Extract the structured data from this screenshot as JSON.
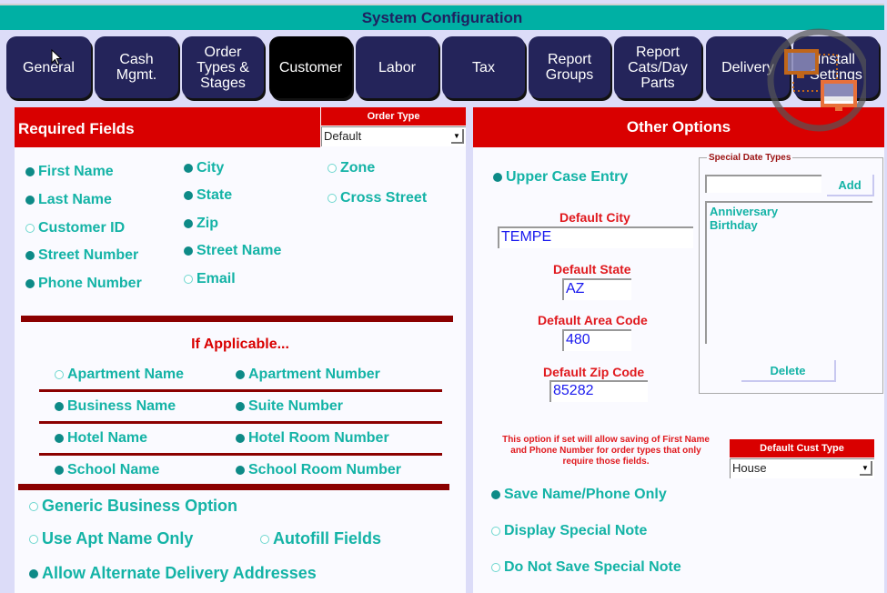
{
  "window": {
    "title": "System Configuration"
  },
  "tabs": [
    {
      "label": "General",
      "active": false
    },
    {
      "label": "Cash\nMgmt.",
      "active": false
    },
    {
      "label": "Order\nTypes &\nStages",
      "active": false
    },
    {
      "label": "Customer",
      "active": true
    },
    {
      "label": "Labor",
      "active": false
    },
    {
      "label": "Tax",
      "active": false
    },
    {
      "label": "Report\nGroups",
      "active": false
    },
    {
      "label": "Report\nCats/Day\nParts",
      "active": false
    },
    {
      "label": "Delivery",
      "active": false
    },
    {
      "label": "Install\nSettings",
      "active": false
    }
  ],
  "required_fields": {
    "header": "Required Fields",
    "order_type": {
      "label": "Order Type",
      "value": "Default"
    },
    "col1": [
      {
        "label": "First Name",
        "checked": true
      },
      {
        "label": "Last Name",
        "checked": true
      },
      {
        "label": "Customer ID",
        "checked": false
      },
      {
        "label": "Street Number",
        "checked": true
      },
      {
        "label": "Phone Number",
        "checked": true
      }
    ],
    "col2": [
      {
        "label": "City",
        "checked": true
      },
      {
        "label": "State",
        "checked": true
      },
      {
        "label": "Zip",
        "checked": true
      },
      {
        "label": "Street Name",
        "checked": true
      },
      {
        "label": "Email",
        "checked": false
      }
    ],
    "col3": [
      {
        "label": "Zone",
        "checked": false
      },
      {
        "label": "Cross Street",
        "checked": false
      }
    ]
  },
  "if_applicable": {
    "header": "If Applicable...",
    "rows": [
      [
        {
          "label": "Apartment Name",
          "checked": false
        },
        {
          "label": "Apartment Number",
          "checked": true
        }
      ],
      [
        {
          "label": "Business Name",
          "checked": true
        },
        {
          "label": "Suite Number",
          "checked": true
        }
      ],
      [
        {
          "label": "Hotel Name",
          "checked": true
        },
        {
          "label": "Hotel Room Number",
          "checked": true
        }
      ],
      [
        {
          "label": "School Name",
          "checked": true
        },
        {
          "label": "School Room Number",
          "checked": true
        }
      ]
    ]
  },
  "bottom_options": {
    "generic_business": {
      "label": "Generic Business Option",
      "checked": false
    },
    "use_apt_name": {
      "label": "Use Apt Name Only",
      "checked": false
    },
    "autofill": {
      "label": "Autofill Fields",
      "checked": false
    },
    "alt_delivery": {
      "label": "Allow Alternate Delivery Addresses",
      "checked": true
    }
  },
  "other_options": {
    "header": "Other Options",
    "upper_case": {
      "label": "Upper Case Entry",
      "checked": true
    },
    "default_city": {
      "label": "Default City",
      "value": "TEMPE"
    },
    "default_state": {
      "label": "Default State",
      "value": "AZ"
    },
    "default_area_code": {
      "label": "Default Area Code",
      "value": "480"
    },
    "default_zip": {
      "label": "Default Zip Code",
      "value": "85282"
    },
    "special_date_types": {
      "legend": "Special Date Types",
      "input_value": "",
      "add_label": "Add",
      "delete_label": "Delete",
      "items": [
        "Anniversary",
        "Birthday"
      ]
    },
    "note": "This option if set will allow saving of First Name and Phone Number for order types that only require those fields.",
    "default_cust_type": {
      "label": "Default Cust Type",
      "value": "House"
    },
    "save_name_phone": {
      "label": "Save Name/Phone Only",
      "checked": true
    },
    "display_special_note": {
      "label": "Display Special Note",
      "checked": false
    },
    "do_not_save_note": {
      "label": "Do Not Save Special Note",
      "checked": false
    }
  },
  "icons": {
    "remote_connection": "remote-connection-icon",
    "cursor": "mouse-pointer-icon"
  },
  "colors": {
    "title_bar": "#00b0a4",
    "tab_bg": "#24245a",
    "tab_active": "#000000",
    "header_red": "#d90000",
    "option_teal": "#14b3a6",
    "divider": "#8b0000",
    "input_text": "#1a1aee"
  }
}
